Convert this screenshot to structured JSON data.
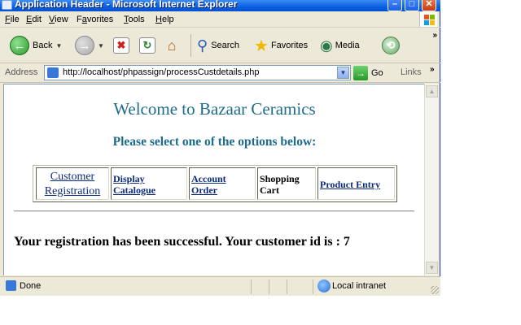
{
  "window": {
    "title": "Application Header - Microsoft Internet Explorer",
    "minimize": "–",
    "maximize": "□",
    "close": "✕"
  },
  "menu": {
    "items": [
      {
        "label": "File",
        "key": "F",
        "rest": "ile"
      },
      {
        "label": "Edit",
        "key": "E",
        "rest": "dit"
      },
      {
        "label": "View",
        "key": "V",
        "rest": "iew"
      },
      {
        "label": "Favorites",
        "key": "a",
        "prefix": "F",
        "rest": "vorites"
      },
      {
        "label": "Tools",
        "key": "T",
        "rest": "ools"
      },
      {
        "label": "Help",
        "key": "H",
        "rest": "elp"
      }
    ]
  },
  "toolbar": {
    "back_label": "Back",
    "search_label": "Search",
    "favorites_label": "Favorites",
    "media_label": "Media",
    "more": "»",
    "back_arrow": "←",
    "forward_arrow": "→",
    "stop_glyph": "✖",
    "refresh_glyph": "↻",
    "home_glyph": "⌂",
    "search_glyph": "⚲",
    "favorites_glyph": "★",
    "media_glyph": "◉",
    "history_glyph": "⟲",
    "dropdown": "▼"
  },
  "address": {
    "label": "Address",
    "url": "http://localhost/phpassign/processCustdetails.php",
    "go_label": "Go",
    "go_arrow": "→",
    "links_label": "Links",
    "links_more": "»",
    "dropdown": "▼"
  },
  "page": {
    "title": "Welcome to Bazaar Ceramics",
    "subtitle": "Please select one of the options below:",
    "options": [
      {
        "line1": "Customer",
        "line2": "Registration"
      },
      {
        "line1": "Display",
        "line2": "Catalogue"
      },
      {
        "line1": "Account",
        "line2": "Order"
      },
      {
        "line1": "Shopping",
        "line2": "Cart"
      },
      {
        "line1": "Product Entry",
        "line2": ""
      }
    ],
    "message": "Your registration has been successful. Your customer id is : 7"
  },
  "scrollbar": {
    "up": "▲",
    "down": "▼"
  },
  "status": {
    "text": "Done",
    "zone": "Local intranet"
  },
  "colors": {
    "heading": "#1e6b8c",
    "link": "#0b2b7a",
    "titlebar": "#0a5fe0"
  }
}
